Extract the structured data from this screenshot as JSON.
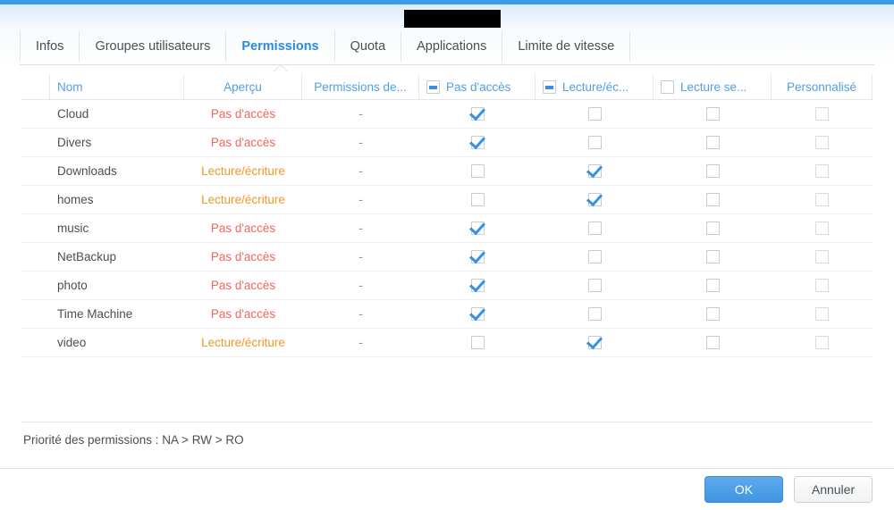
{
  "window": {
    "title_redacted": true,
    "accent_color": "#3a9ae8"
  },
  "tabs": [
    {
      "label": "Infos",
      "active": false
    },
    {
      "label": "Groupes utilisateurs",
      "active": false
    },
    {
      "label": "Permissions",
      "active": true
    },
    {
      "label": "Quota",
      "active": false
    },
    {
      "label": "Applications",
      "active": false
    },
    {
      "label": "Limite de vitesse",
      "active": false
    }
  ],
  "table": {
    "columns": [
      {
        "key": "gap",
        "label": "",
        "type": "spacer"
      },
      {
        "key": "name",
        "label": "Nom",
        "type": "text"
      },
      {
        "key": "prev",
        "label": "Aperçu",
        "type": "text"
      },
      {
        "key": "perm",
        "label": "Permissions de...",
        "type": "text"
      },
      {
        "key": "na",
        "label": "Pas d'accès",
        "type": "checkbox",
        "header_state": "indeterminate"
      },
      {
        "key": "rw",
        "label": "Lecture/éc...",
        "type": "checkbox",
        "header_state": "indeterminate"
      },
      {
        "key": "ro",
        "label": "Lecture se...",
        "type": "checkbox",
        "header_state": "unchecked"
      },
      {
        "key": "cust",
        "label": "Personnalisé",
        "type": "plain"
      }
    ],
    "rows": [
      {
        "name": "Cloud",
        "preview": "Pas d'accès",
        "preview_kind": "na",
        "perm": "-",
        "na": true,
        "rw": false,
        "ro": false,
        "cust": false
      },
      {
        "name": "Divers",
        "preview": "Pas d'accès",
        "preview_kind": "na",
        "perm": "-",
        "na": true,
        "rw": false,
        "ro": false,
        "cust": false
      },
      {
        "name": "Downloads",
        "preview": "Lecture/écriture",
        "preview_kind": "rw",
        "perm": "-",
        "na": false,
        "rw": true,
        "ro": false,
        "cust": false
      },
      {
        "name": "homes",
        "preview": "Lecture/écriture",
        "preview_kind": "rw",
        "perm": "-",
        "na": false,
        "rw": true,
        "ro": false,
        "cust": false
      },
      {
        "name": "music",
        "preview": "Pas d'accès",
        "preview_kind": "na",
        "perm": "-",
        "na": true,
        "rw": false,
        "ro": false,
        "cust": false
      },
      {
        "name": "NetBackup",
        "preview": "Pas d'accès",
        "preview_kind": "na",
        "perm": "-",
        "na": true,
        "rw": false,
        "ro": false,
        "cust": false
      },
      {
        "name": "photo",
        "preview": "Pas d'accès",
        "preview_kind": "na",
        "perm": "-",
        "na": true,
        "rw": false,
        "ro": false,
        "cust": false
      },
      {
        "name": "Time Machine",
        "preview": "Pas d'accès",
        "preview_kind": "na",
        "perm": "-",
        "na": true,
        "rw": false,
        "ro": false,
        "cust": false
      },
      {
        "name": "video",
        "preview": "Lecture/écriture",
        "preview_kind": "rw",
        "perm": "-",
        "na": false,
        "rw": true,
        "ro": false,
        "cust": false
      }
    ]
  },
  "footer": {
    "note": "Priorité des permissions : NA > RW > RO",
    "ok_label": "OK",
    "cancel_label": "Annuler"
  },
  "colors": {
    "accent_blue": "#3a9ae8",
    "header_link_blue": "#4f9fe8",
    "no_access_red": "#f2675f",
    "read_write_orange": "#f0962a",
    "checkbox_blue": "#3b8fe0"
  }
}
